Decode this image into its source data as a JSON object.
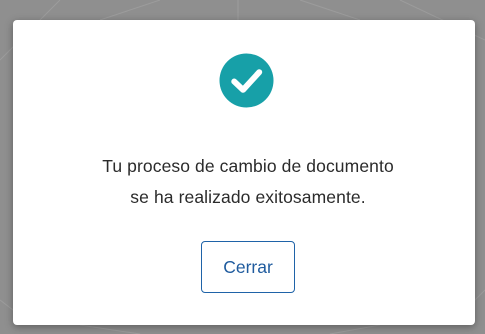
{
  "dialog": {
    "icon": "check-circle-icon",
    "message_line1": "Tu proceso de cambio de documento",
    "message_line2": "se ha realizado exitosamente.",
    "close_label": "Cerrar"
  },
  "colors": {
    "success": "#17a0a8",
    "accent": "#1f5b9e",
    "text": "#2b2b2b",
    "overlay": "#8f8f8f"
  }
}
